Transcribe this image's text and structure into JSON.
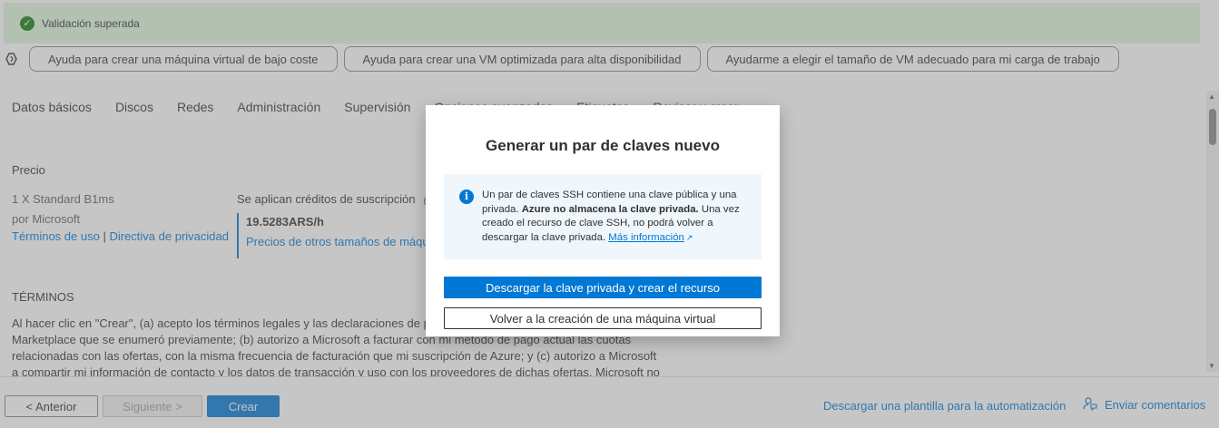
{
  "banner": {
    "icon": "check-circle-icon",
    "text": "Validación superada"
  },
  "copilot": {
    "icon": "copilot-icon",
    "suggestions": [
      "Ayuda para crear una máquina virtual de bajo coste",
      "Ayuda para crear una VM optimizada para alta disponibilidad",
      "Ayudarme a elegir el tamaño de VM adecuado para mi carga de trabajo"
    ]
  },
  "tabs": [
    "Datos básicos",
    "Discos",
    "Redes",
    "Administración",
    "Supervisión",
    "Opciones avanzadas",
    "Etiquetas",
    "Revisar y crear"
  ],
  "price": {
    "heading": "Precio",
    "sku": "1 X Standard B1ms",
    "publisher": "por Microsoft",
    "terms_link": "Términos de uso",
    "separator": "|",
    "privacy_link": "Directiva de privacidad",
    "credits_text": "Se aplican créditos de suscripción",
    "credits_info_icon": "info-icon",
    "amount": "19.5283ARS/h",
    "other_sizes_link": "Precios de otros tamaños de máquina virtual"
  },
  "terms": {
    "heading": "TÉRMINOS",
    "body": "Al hacer clic en \"Crear\", (a) acepto los términos legales y las declaraciones de privacidad asociados con las ofertas de Marketplace que se enumeró previamente; (b) autorizo a Microsoft a facturar con mi método de pago actual las cuotas relacionadas con las ofertas, con la misma frecuencia de facturación que mi suscripción de Azure; y (c) autorizo a Microsoft a compartir mi información de contacto y los datos de transacción y uso con los proveedores de dichas ofertas. Microsoft no"
  },
  "footer": {
    "prev": "< Anterior",
    "next": "Siguiente >",
    "create": "Crear",
    "download_template": "Descargar una plantilla para la automatización",
    "feedback_icon": "feedback-icon",
    "feedback": "Enviar comentarios"
  },
  "dialog": {
    "title": "Generar un par de claves nuevo",
    "info_icon": "info-icon",
    "info_text_1": "Un par de claves SSH contiene una clave pública y una privada. ",
    "info_bold": "Azure no almacena la clave privada.",
    "info_text_2": " Una vez creado el recurso de clave SSH, no podrá volver a descargar la clave privada. ",
    "info_link": "Más información",
    "external_link_icon": "external-link-icon",
    "primary_button": "Descargar la clave privada y crear el recurso",
    "secondary_button": "Volver a la creación de una máquina virtual"
  },
  "colors": {
    "accent": "#0078d4",
    "success": "#107c10",
    "banner_bg": "#dff6dd",
    "info_bg": "#eff6fc"
  }
}
